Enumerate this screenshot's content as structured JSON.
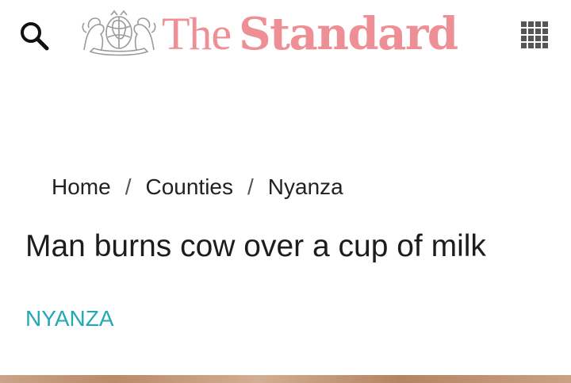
{
  "header": {
    "search_icon": "search-icon",
    "logo_crest_icon": "coat-of-arms-icon",
    "logo_the": "The",
    "logo_standard": "Standard",
    "menu_icon": "grid-menu-icon",
    "logo_color": "#ee8f95"
  },
  "breadcrumb": {
    "items": [
      "Home",
      "Counties",
      "Nyanza"
    ],
    "separator": "/"
  },
  "article": {
    "title": "Man burns cow over a cup of milk",
    "category": "NYANZA",
    "category_color": "#22a9b5"
  }
}
